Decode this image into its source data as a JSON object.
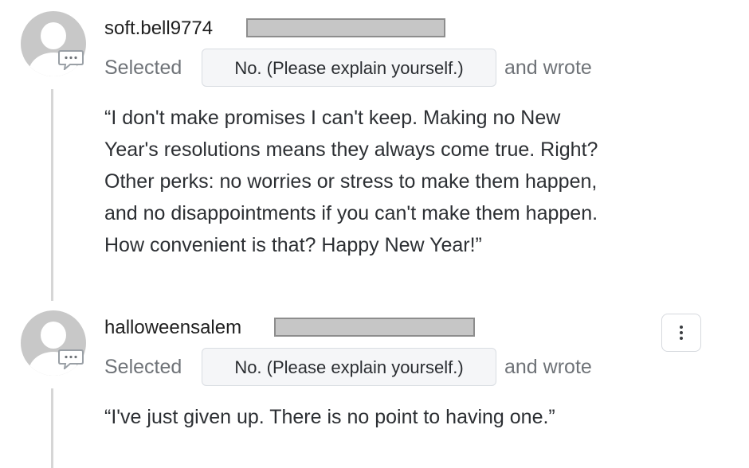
{
  "comments": [
    {
      "username": "soft.bell9774",
      "selected_prefix": "Selected",
      "choice": "No. (Please explain yourself.)",
      "wrote_suffix": "and wrote",
      "body_lines": [
        "“I don't make promises I can't keep. Making no New",
        "Year's resolutions means they always come true. Right?",
        "Other perks: no worries or stress to make them happen,",
        "and no disappointments if you can't make them happen.",
        "How convenient is that? Happy New Year!”"
      ],
      "avatar_icon": "default-avatar-icon",
      "badge_icon": "comment-bubble-icon"
    },
    {
      "username": "halloweensalem",
      "selected_prefix": "Selected",
      "choice": "No. (Please explain yourself.)",
      "wrote_suffix": "and wrote",
      "body_lines": [
        "“I've just given up. There is no point to having one.”"
      ],
      "avatar_icon": "default-avatar-icon",
      "badge_icon": "comment-bubble-icon",
      "menu_icon": "more-vertical-icon"
    }
  ],
  "colors": {
    "avatar_gray": "#c8c8c8",
    "muted_text": "#6f7378",
    "chip_background": "#f5f6f8",
    "thread_line": "#d6d6d6",
    "redaction": "#c6c6c6"
  }
}
